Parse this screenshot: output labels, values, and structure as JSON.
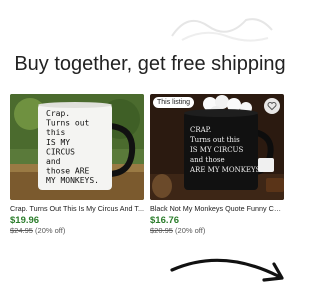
{
  "headline": "Buy together, get free shipping",
  "products": [
    {
      "mug_text": [
        "Crap.",
        "Turns out",
        "this",
        "IS MY",
        "CIRCUS",
        "and",
        "those ARE",
        "MY MONKEYS."
      ],
      "title": "Crap. Turns Out This Is My Circus And T...",
      "price": "$19.96",
      "original_price": "$24.95",
      "discount": "(20% off)"
    },
    {
      "badge": "This listing",
      "mug_text": [
        "CRAP.",
        "Turns out this",
        "IS MY CIRCUS",
        "and those",
        "ARE MY MONKEYS."
      ],
      "title": "Black Not My Monkeys Quote Funny Cof...",
      "price": "$16.76",
      "original_price": "$20.95",
      "discount": "(20% off)"
    }
  ],
  "colors": {
    "price_green": "#2b7d2b",
    "headline": "#222222",
    "muted": "#595959"
  },
  "icons": {
    "favorite": "heart-icon",
    "arrow": "curved-arrow-icon"
  }
}
